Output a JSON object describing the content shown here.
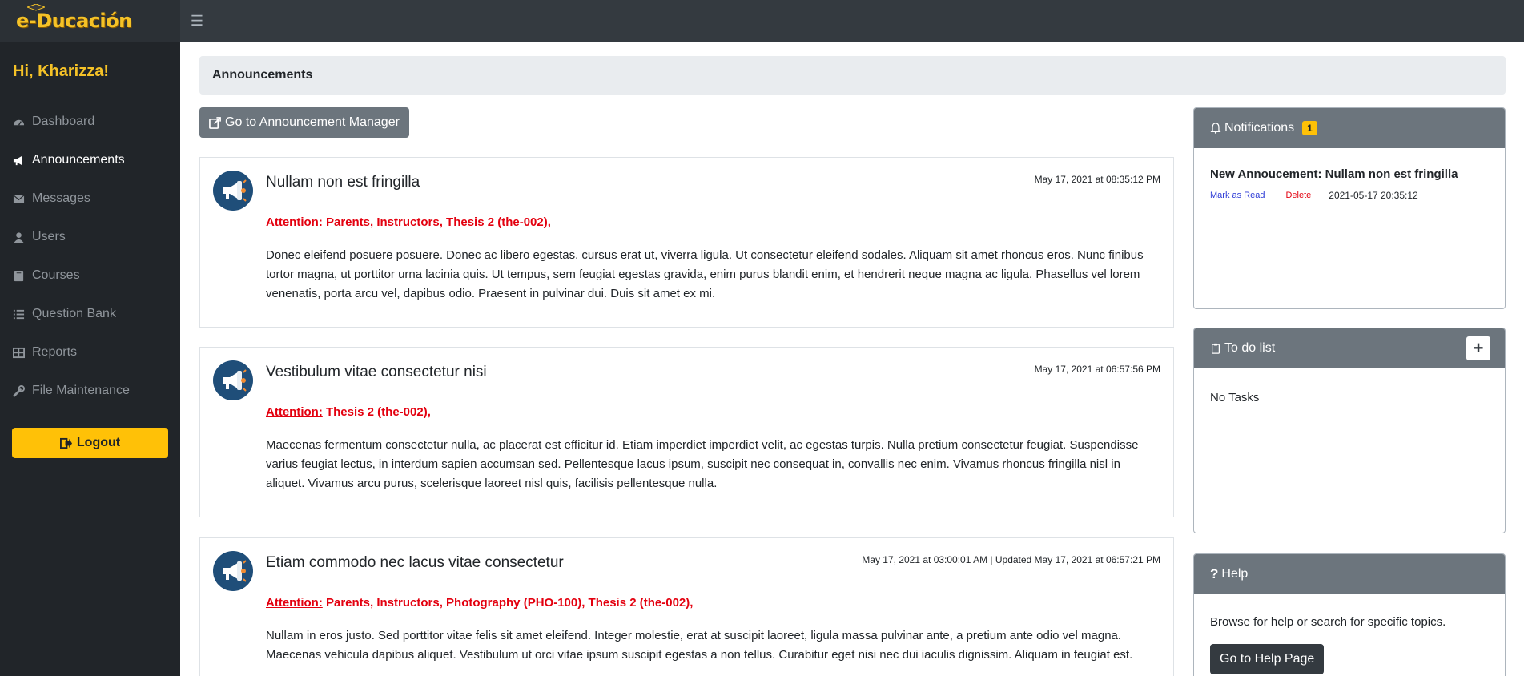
{
  "brand": {
    "logo_text": "e-Ducación"
  },
  "sidebar": {
    "greeting": "Hi, Kharizza!",
    "items": [
      {
        "label": "Dashboard",
        "icon": "dashboard-icon"
      },
      {
        "label": "Announcements",
        "icon": "megaphone-icon"
      },
      {
        "label": "Messages",
        "icon": "envelope-icon"
      },
      {
        "label": "Users",
        "icon": "user-icon"
      },
      {
        "label": "Courses",
        "icon": "book-icon"
      },
      {
        "label": "Question Bank",
        "icon": "list-icon"
      },
      {
        "label": "Reports",
        "icon": "table-icon"
      },
      {
        "label": "File Maintenance",
        "icon": "wrench-icon"
      }
    ],
    "logout_label": "Logout"
  },
  "header": {
    "page_title": "Announcements"
  },
  "main": {
    "manager_button": "Go to Announcement Manager",
    "attention_label": "Attention:",
    "posts": [
      {
        "title": "Nullam non est fringilla",
        "date": "May 17, 2021 at 08:35:12 PM",
        "recipients": "Parents, Instructors, Thesis 2 (the-002),",
        "body": "Donec eleifend posuere posuere. Donec ac libero egestas, cursus erat ut, viverra ligula. Ut consectetur eleifend sodales. Aliquam sit amet rhoncus eros. Nunc finibus tortor magna, ut porttitor urna lacinia quis. Ut tempus, sem feugiat egestas gravida, enim purus blandit enim, et hendrerit neque magna ac ligula. Phasellus vel lorem venenatis, porta arcu vel, dapibus odio. Praesent in pulvinar dui. Duis sit amet ex mi."
      },
      {
        "title": "Vestibulum vitae consectetur nisi",
        "date": "May 17, 2021 at 06:57:56 PM",
        "recipients": "Thesis 2 (the-002),",
        "body": "Maecenas fermentum consectetur nulla, ac placerat est efficitur id. Etiam imperdiet imperdiet velit, ac egestas turpis. Nulla pretium consectetur feugiat. Suspendisse varius feugiat lectus, in interdum sapien accumsan sed. Pellentesque lacus ipsum, suscipit nec consequat in, convallis nec enim. Vivamus rhoncus fringilla nisl in aliquet. Vivamus arcu purus, scelerisque laoreet nisl quis, facilisis pellentesque nulla."
      },
      {
        "title": "Etiam commodo nec lacus vitae consectetur",
        "date": "May 17, 2021 at 03:00:01 AM | Updated May 17, 2021 at 06:57:21 PM",
        "recipients": "Parents, Instructors, Photography (PHO-100), Thesis 2 (the-002),",
        "body": "Nullam in eros justo. Sed porttitor vitae felis sit amet eleifend. Integer molestie, erat at suscipit laoreet, ligula massa pulvinar ante, a pretium ante odio vel magna. Maecenas vehicula dapibus aliquet. Vestibulum ut orci vitae ipsum suscipit egestas a non tellus. Curabitur eget nisi nec dui iaculis dignissim. Aliquam in feugiat est."
      }
    ]
  },
  "notifications": {
    "title": "Notifications",
    "count": "1",
    "item_title": "New Annoucement: Nullam non est fringilla",
    "mark_read": "Mark as Read",
    "delete": "Delete",
    "timestamp": "2021-05-17 20:35:12"
  },
  "todo": {
    "title": "To do list",
    "add_label": "+",
    "empty_text": "No Tasks"
  },
  "help": {
    "title": "Help",
    "text": "Browse for help or search for specific topics.",
    "button": "Go to Help Page"
  },
  "colors": {
    "accent": "#ffc107",
    "sidebar_bg": "#212529",
    "topbar_bg": "#343a40",
    "attention": "#e3000f",
    "panel_head": "#6c757d"
  }
}
